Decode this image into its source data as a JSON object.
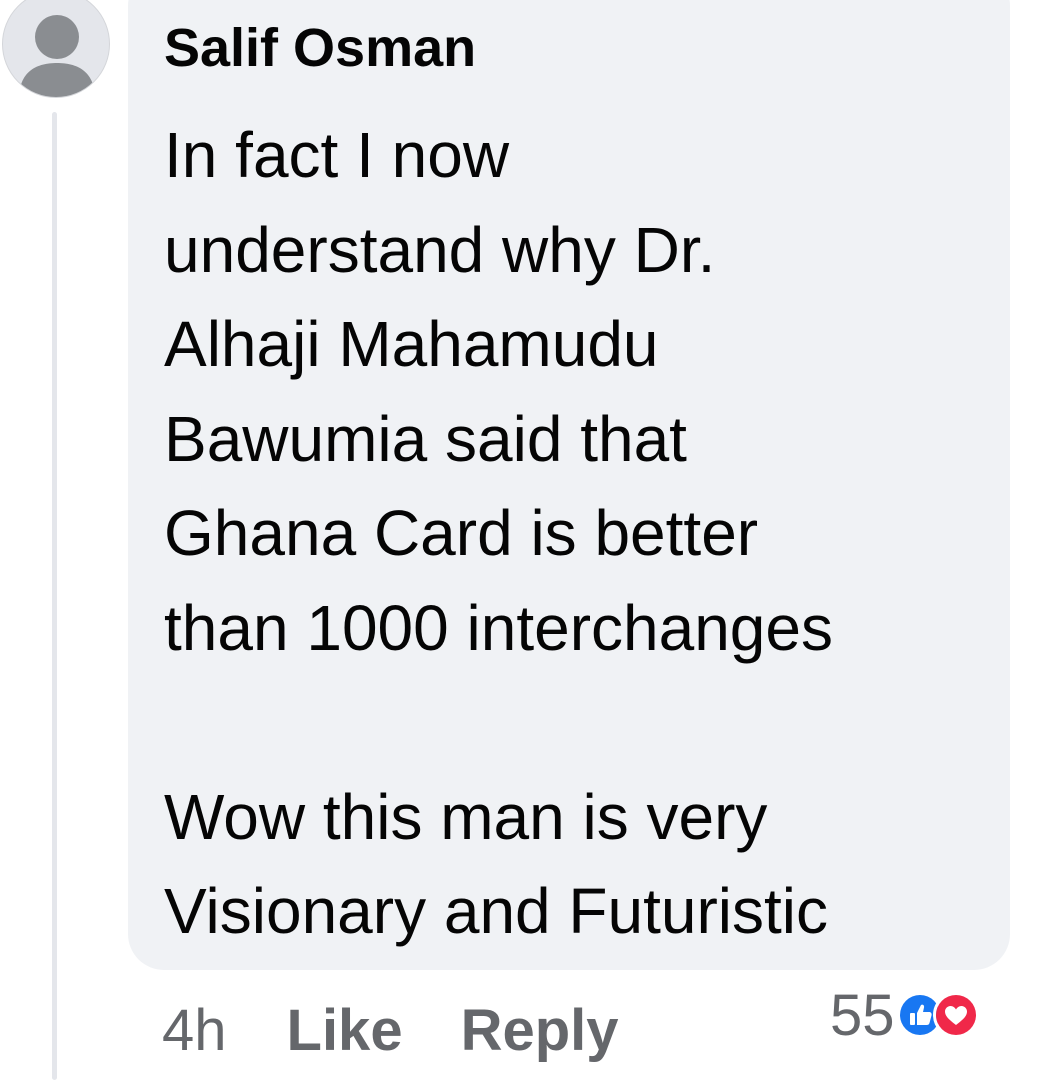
{
  "comment": {
    "author": "Salif Osman",
    "text_lines": [
      "In fact I now",
      "understand why Dr.",
      "Alhaji Mahamudu",
      "Bawumia said that",
      "Ghana Card is better",
      "than 1000 interchanges",
      "",
      "Wow this man is very",
      "Visionary and Futuristic"
    ]
  },
  "actions": {
    "time": "4h",
    "like_label": "Like",
    "reply_label": "Reply"
  },
  "reactions": {
    "count": "55",
    "icons": [
      "like-icon",
      "love-icon"
    ]
  },
  "colors": {
    "bubble": "#f0f2f5",
    "text": "#050505",
    "muted": "#65676b",
    "like_blue": "#1877f2",
    "love_red": "#f02849"
  }
}
